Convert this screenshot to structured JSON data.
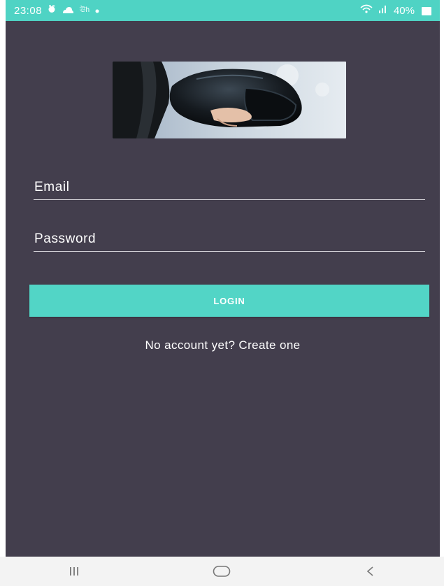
{
  "status_bar": {
    "time": "23:08",
    "notification_text": "ঊh",
    "battery": "40%"
  },
  "login": {
    "email_placeholder": "Email",
    "password_placeholder": "Password",
    "login_label": "LOGIN",
    "create_account_text": "No account yet? Create one"
  },
  "colors": {
    "background": "#433e4d",
    "accent": "#52d5c6",
    "status_bar": "#4fd3c4",
    "nav_bar": "#f3f3f3"
  },
  "icons": {
    "status_left": [
      "alarm-icon",
      "cloud-icon",
      "dot-icon"
    ],
    "status_right": [
      "wifi-icon",
      "signal-icon",
      "battery-icon"
    ],
    "navigation": [
      "recent-apps-icon",
      "home-icon",
      "back-icon"
    ]
  }
}
